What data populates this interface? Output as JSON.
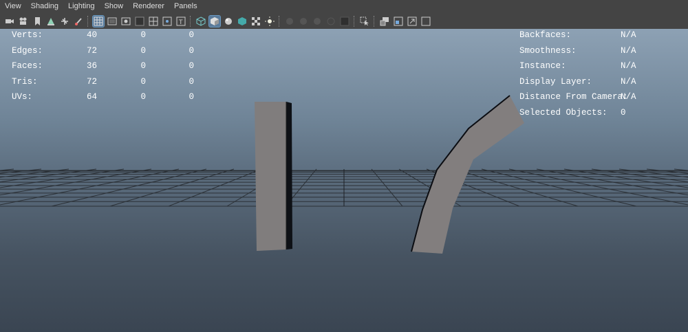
{
  "menu": [
    "View",
    "Shading",
    "Lighting",
    "Show",
    "Renderer",
    "Panels"
  ],
  "toolbar_icons": [
    "camera-icon",
    "film-camera-icon",
    "bookmark-icon",
    "image-plane-icon",
    "cube-transform-icon",
    "brush-icon",
    "grid-icon",
    "film-gate-icon",
    "resolution-gate-icon",
    "gate-mask-icon",
    "field-chart-icon",
    "safe-action-icon",
    "safe-title-icon",
    "wireframe-icon",
    "smooth-shade-icon",
    "default-material-icon",
    "xray-icon",
    "textured-icon",
    "lights-icon",
    "shadows-icon",
    "ambient-occlusion-icon",
    "motion-blur-icon",
    "anti-aliasing-icon",
    "depth-of-field-icon",
    "isolate-select-icon",
    "xray-joints-icon",
    "xray-components-icon",
    "component-view-icon",
    "wireframe-on-shaded-icon"
  ],
  "stats_left": {
    "rows": [
      {
        "label": "Verts:",
        "v1": "40",
        "v2": "0",
        "v3": "0"
      },
      {
        "label": "Edges:",
        "v1": "72",
        "v2": "0",
        "v3": "0"
      },
      {
        "label": "Faces:",
        "v1": "36",
        "v2": "0",
        "v3": "0"
      },
      {
        "label": "Tris:",
        "v1": "72",
        "v2": "0",
        "v3": "0"
      },
      {
        "label": "UVs:",
        "v1": "64",
        "v2": "0",
        "v3": "0"
      }
    ]
  },
  "stats_right": {
    "rows": [
      {
        "label": "Backfaces:",
        "value": "N/A"
      },
      {
        "label": "Smoothness:",
        "value": "N/A"
      },
      {
        "label": "Instance:",
        "value": "N/A"
      },
      {
        "label": "Display Layer:",
        "value": "N/A"
      },
      {
        "label": "Distance From Camera:",
        "value": "N/A"
      },
      {
        "label": "Selected Objects:",
        "value": "0"
      }
    ]
  }
}
